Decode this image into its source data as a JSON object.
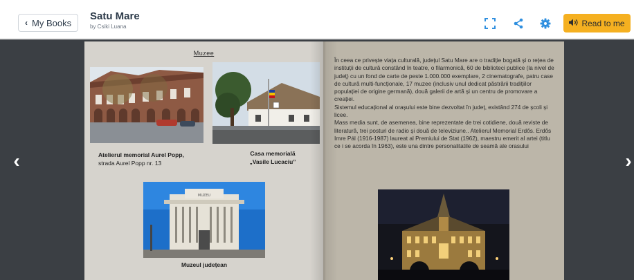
{
  "header": {
    "back_label": "My Books",
    "title": "Satu Mare",
    "author": "by Csiki Luana",
    "read_label": "Read to me"
  },
  "colors": {
    "accent": "#f5b020",
    "icon_blue": "#2f8fdf",
    "stage_bg": "#3b3f44"
  },
  "icons": [
    "fullscreen-icon",
    "share-icon",
    "gear-icon",
    "speaker-icon"
  ],
  "left_page": {
    "heading": "Muzee",
    "captions": {
      "aurel_title": "Atelierul memorial Aurel Popp,",
      "aurel_sub": "strada Aurel Popp nr. 13",
      "lucaciu_title": "Casa memorială",
      "lucaciu_sub": "„Vasile Lucaciu”",
      "museum": "Muzeul județean"
    },
    "museum_sign": "MUZEU"
  },
  "right_page": {
    "paragraphs": [
      "În ceea ce privește viața culturală, județul Satu Mare are o tradiție bogată și o rețea de instituții de cultură constând în teatre, o filarmonică, 60 de biblioteci publice (la nivel de județ) cu un fond de carte de peste 1.000.000 exemplare, 2 cinematografe, patru case de cultură multi-funcționale, 17 muzee (inclusiv unul dedicat păstrării tradițiilor populației de origine germană), două galerii de artă și un centru de promovare a creației.",
      "Sistemul educațional al orașului este bine dezvoltat în județ, existând 274 de școli și licee.",
      "Mass media sunt, de asemenea, bine reprezentate de trei cotidiene, două reviste de literatură, trei posturi de radio și două de televiziune.. Atelierul Memorial Erdős. Erdős Imre Pál (1916-1987) laureat al Premiului de Stat (1962), maestru emerit al artei (titlu ce i se acorda în 1963), este una dintre personalitatile de seamă ale orasului"
    ]
  }
}
